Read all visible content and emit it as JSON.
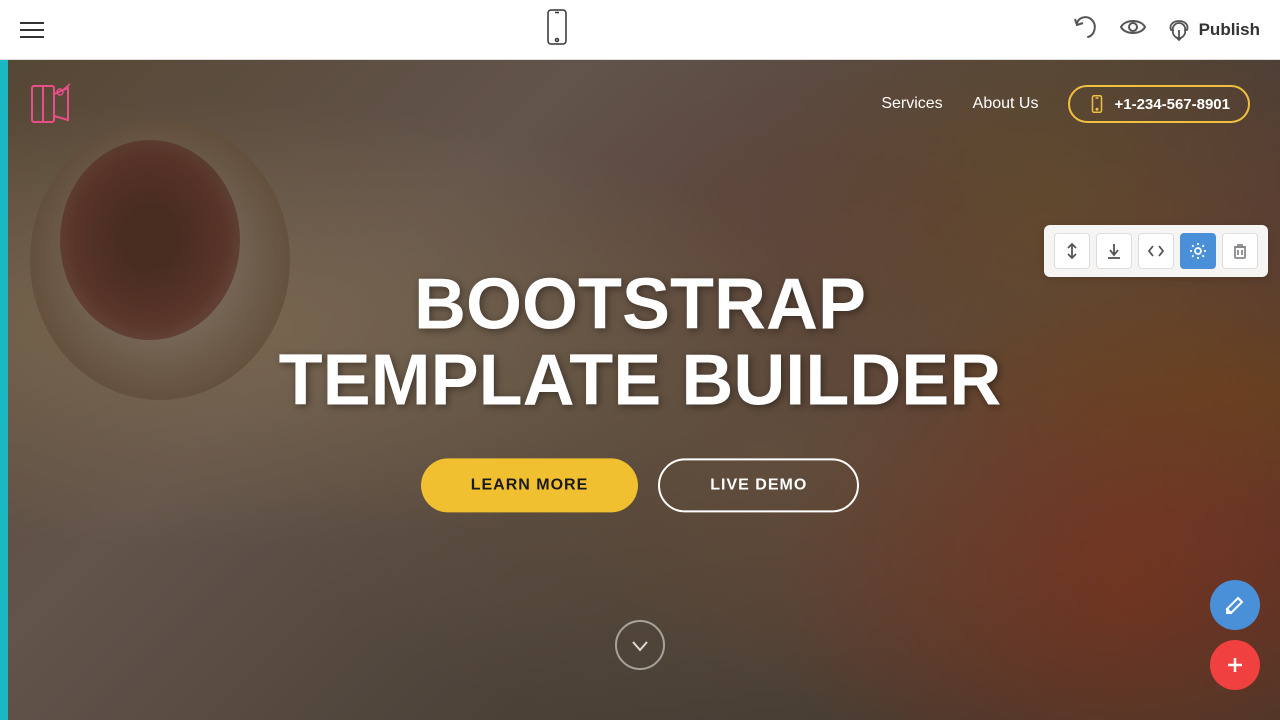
{
  "toolbar": {
    "publish_label": "Publish",
    "hamburger_label": "Menu"
  },
  "site": {
    "nav_items": [
      {
        "label": "Services",
        "id": "services"
      },
      {
        "label": "About Us",
        "id": "about-us"
      }
    ],
    "phone": "+1-234-567-8901",
    "hero_title_line1": "BOOTSTRAP",
    "hero_title_line2": "TEMPLATE BUILDER",
    "btn_learn_more": "LEARN MORE",
    "btn_live_demo": "LIVE DEMO"
  },
  "section_tools": [
    {
      "icon": "sort-icon",
      "label": "Sort"
    },
    {
      "icon": "download-icon",
      "label": "Download"
    },
    {
      "icon": "code-icon",
      "label": "Code"
    },
    {
      "icon": "settings-icon",
      "label": "Settings",
      "active": true
    },
    {
      "icon": "trash-icon",
      "label": "Delete"
    }
  ],
  "float_buttons": [
    {
      "icon": "edit-icon",
      "color": "blue"
    },
    {
      "icon": "plus-icon",
      "color": "red"
    }
  ]
}
